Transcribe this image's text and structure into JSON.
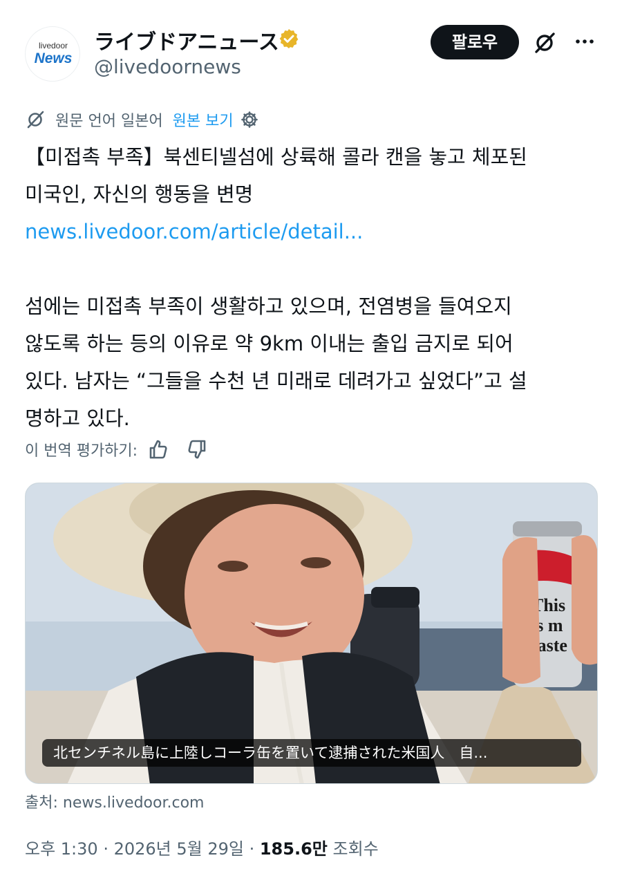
{
  "account": {
    "avatar_brand_top": "livedoor",
    "avatar_brand_main": "News",
    "display_name": "ライブドアニュース",
    "handle": "@livedoornews",
    "verified_badge_color": "#e8b529"
  },
  "actions": {
    "follow_label": "팔로우",
    "grok_icon": "grok-icon",
    "more_icon": "more-icon"
  },
  "translation": {
    "original_language_label": "원문 언어 일본어",
    "view_original_label": "원본 보기",
    "settings_icon": "gear-icon"
  },
  "tweet": {
    "line1": "【미접촉 부족】북센티넬섬에 상륙해 콜라 캔을 놓고 체포된",
    "line2": "미국인, 자신의 행동을 변명",
    "link": "news.livedoor.com/article/detail...",
    "body_line1": "섬에는 미접촉 부족이 생활하고 있으며, 전염병을 들여오지",
    "body_line2": "않도록 하는 등의 이유로 약 9km 이내는 출입 금지로 되어",
    "body_line3": "있다. 남자는 “그들을 수천 년 미래로 데려가고 싶었다”고 설",
    "body_line4": "명하고 있다."
  },
  "rating": {
    "label": "이 번역 평가하기:",
    "thumbs_up_icon": "thumbs-up-icon",
    "thumbs_down_icon": "thumbs-down-icon"
  },
  "media": {
    "caption": "北センチネル島に上陸しコーラ缶を置いて逮捕された米国人　自...",
    "can_text_1": "This",
    "can_text_2": "is m",
    "can_text_3": "taste"
  },
  "source": "출처: news.livedoor.com",
  "meta": {
    "time": "오후 1:30",
    "separator": " · ",
    "date": "2026년 5월 29일",
    "views_count": "185.6만",
    "views_label": " 조회수"
  },
  "colors": {
    "link": "#1d9bf0",
    "secondary_text": "#536471",
    "primary_text": "#0f1419"
  }
}
